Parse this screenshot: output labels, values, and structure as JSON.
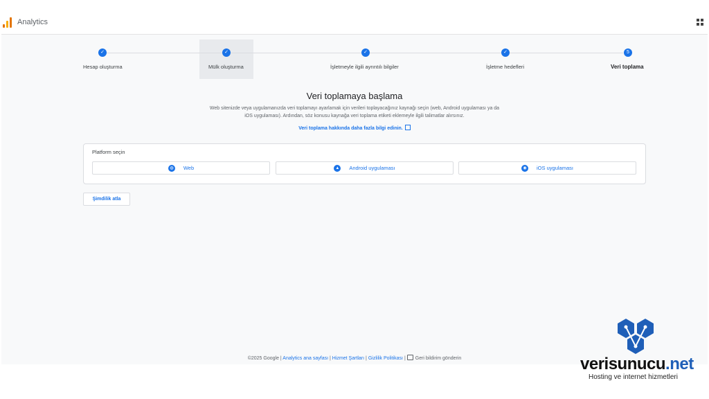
{
  "header": {
    "app_title": "Analytics",
    "apps_icon": "apps-grid-icon"
  },
  "steps": [
    {
      "label": "Hesap oluşturma",
      "mark": "✓",
      "state": "done"
    },
    {
      "label": "Mülk oluşturma",
      "mark": "✓",
      "state": "done"
    },
    {
      "label": "İşletmeyle ilgili ayrıntılı bilgiler",
      "mark": "✓",
      "state": "done"
    },
    {
      "label": "İşletme hedefleri",
      "mark": "✓",
      "state": "done"
    },
    {
      "label": "Veri toplama",
      "mark": "5",
      "state": "current"
    }
  ],
  "main": {
    "headline": "Veri toplamaya başlama",
    "description": "Web sitenizde veya uygulamanızda veri toplamayı ayarlamak için verileri toplayacağınız kaynağı seçin (web, Android uygulaması ya da iOS uygulaması). Ardından, söz konusu kaynağa veri toplama etiketi eklemeyle ilgili talimatlar alırsınız.",
    "learn_more": "Veri toplama hakkında daha fazla bilgi edinin."
  },
  "platform": {
    "title": "Platform seçin",
    "buttons": [
      {
        "label": "Web",
        "icon": "globe-icon"
      },
      {
        "label": "Android uygulaması",
        "icon": "android-icon"
      },
      {
        "label": "iOS uygulaması",
        "icon": "ios-icon"
      }
    ]
  },
  "skip_label": "Şimdilik atla",
  "footer": {
    "copyright": "©2025 Google |",
    "home_link": "Analytics ana sayfası",
    "sep1": "|",
    "terms_link": "Hizmet Şartları",
    "sep2": "|",
    "privacy_link": "Gizlilik Politikası",
    "sep3": "|",
    "feedback": "Geri bildirim gönderin"
  },
  "watermark": {
    "name": "verisunucu",
    "tld": ".net",
    "subtitle": "Hosting ve internet hizmetleri"
  },
  "colors": {
    "accent": "#1a73e8",
    "background": "#f8f9fa",
    "logo_orange": "#e37400",
    "logo_yellow": "#f9ab00",
    "watermark_blue": "#1f5fb8"
  }
}
